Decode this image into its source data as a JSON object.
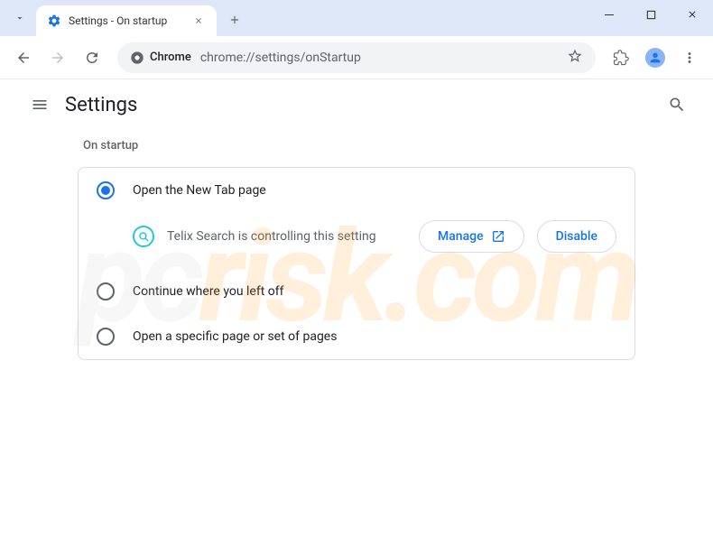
{
  "window": {
    "tab_title": "Settings - On startup"
  },
  "toolbar": {
    "chrome_label": "Chrome",
    "url": "chrome://settings/onStartup"
  },
  "page": {
    "title": "Settings",
    "section_title": "On startup"
  },
  "options": {
    "option1": "Open the New Tab page",
    "option2": "Continue where you left off",
    "option3": "Open a specific page or set of pages"
  },
  "controlled": {
    "extension_name": "Telix Search",
    "message": "Telix Search is controlling this setting",
    "manage_label": "Manage",
    "disable_label": "Disable"
  },
  "watermark": {
    "pc": "pc",
    "risk": "risk",
    "com": ".com"
  }
}
